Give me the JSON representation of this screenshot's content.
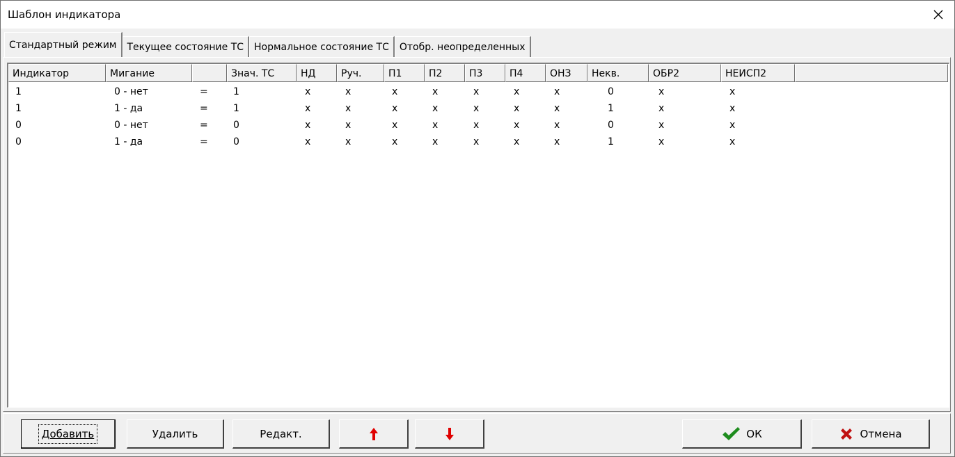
{
  "window": {
    "title": "Шаблон индикатора"
  },
  "tabs": [
    {
      "label": "Стандартный режим",
      "active": true
    },
    {
      "label": "Текущее состояние ТС",
      "active": false
    },
    {
      "label": "Нормальное состояние ТС",
      "active": false
    },
    {
      "label": "Отобр. неопределенных",
      "active": false
    }
  ],
  "table": {
    "columns": [
      "Индикатор",
      "Мигание",
      "",
      "Знач. ТС",
      "НД",
      "Руч.",
      "П1",
      "П2",
      "П3",
      "П4",
      "ОНЗ",
      "Некв.",
      "ОБР2",
      "НЕИСП2",
      ""
    ],
    "rows": [
      [
        "1",
        "0 - нет",
        "=",
        "1",
        "x",
        "x",
        "x",
        "x",
        "x",
        "x",
        "x",
        "0",
        "x",
        "x"
      ],
      [
        "1",
        "1 - да",
        "=",
        "1",
        "x",
        "x",
        "x",
        "x",
        "x",
        "x",
        "x",
        "1",
        "x",
        "x"
      ],
      [
        "0",
        "0 - нет",
        "=",
        "0",
        "x",
        "x",
        "x",
        "x",
        "x",
        "x",
        "x",
        "0",
        "x",
        "x"
      ],
      [
        "0",
        "1 - да",
        "=",
        "0",
        "x",
        "x",
        "x",
        "x",
        "x",
        "x",
        "x",
        "1",
        "x",
        "x"
      ]
    ]
  },
  "buttons": {
    "add": "Добавить",
    "delete": "Удалить",
    "edit": "Редакт.",
    "up_icon": "arrow-up-icon",
    "down_icon": "arrow-down-icon",
    "ok": "ОК",
    "cancel": "Отмена"
  },
  "colors": {
    "arrow": "#e00000",
    "ok_check": "#1e8c1e",
    "cancel_x": "#c01010"
  }
}
